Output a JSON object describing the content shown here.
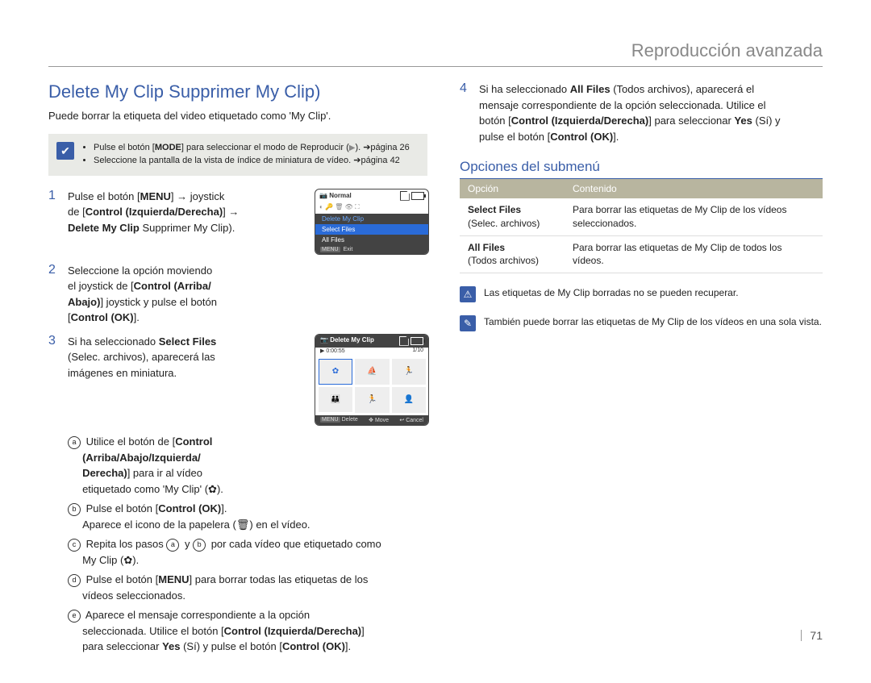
{
  "header": {
    "chapter": "Reproducción avanzada"
  },
  "title": "Delete My Clip Supprimer My Clip)",
  "intro": "Puede borrar la etiqueta del video etiquetado como 'My Clip'.",
  "note_box": {
    "b1a": "Pulse el botón [",
    "b1mode": "MODE",
    "b1b": "] para seleccionar el modo de Reproducir (",
    "b1c": "). ➔página 26",
    "b2": "Seleccione la pantalla de la vista de índice de miniatura de vídeo. ➔página 42"
  },
  "steps": {
    "s1": {
      "num": "1",
      "l1a": "Pulse el botón [",
      "l1b": "MENU",
      "l1c": "] → joystick",
      "l2a": "de [",
      "l2b": "Control (Izquierda/Derecha)",
      "l2c": "] →",
      "l3a": "Delete My Clip",
      "l3b": " Supprimer My Clip)."
    },
    "s2": {
      "num": "2",
      "l1": "Seleccione la opción moviendo",
      "l2a": "el joystick de [",
      "l2b": "Control (Arriba/",
      "l2c": "",
      "l3a": "Abajo)",
      "l3b": "] joystick y pulse el botón",
      "l4a": "[",
      "l4b": "Control (OK)",
      "l4c": "]."
    },
    "s3": {
      "num": "3",
      "l1a": "Si ha seleccionado ",
      "l1b": "Select Files",
      "l2": "(Selec. archivos), aparecerá las",
      "l3": "imágenes en miniatura.",
      "a": {
        "pre": "Utilice el botón de [",
        "bold1": "Control",
        "bold2": "(Arriba/Abajo/Izquierda/",
        "bold3": "Derecha)",
        "post": "] para ir al vídeo",
        "post2": "etiquetado como 'My Clip' (",
        "post3": ")."
      },
      "b": {
        "pre": "Pulse el botón [",
        "bold": "Control (OK)",
        "post": "].",
        "post2": "Aparece el icono de la papelera (",
        "post3": ") en el vídeo."
      },
      "c": {
        "pre": "Repita los pasos ",
        "mid1": " y ",
        "mid2": " por cada vídeo que etiquetado como",
        "post": "My Clip (",
        "post2": ")."
      },
      "d": {
        "pre": "Pulse el botón [",
        "bold": "MENU",
        "post": "] para borrar todas las etiquetas de los",
        "post2": "vídeos seleccionados."
      },
      "e": {
        "l1": "Aparece el mensaje correspondiente a la opción",
        "l2a": "seleccionada. Utilice el botón [",
        "l2b": "Control (Izquierda/Derecha)",
        "l2c": "]",
        "l3a": "para seleccionar ",
        "l3b": "Yes",
        "l3c": " (Sí) y pulse el botón [",
        "l3d": "Control (OK)",
        "l3e": "]."
      }
    },
    "s4": {
      "num": "4",
      "l1a": "Si ha seleccionado ",
      "l1b": "All Files",
      "l1c": " (Todos archivos), aparecerá el",
      "l2": "mensaje correspondiente de la opción seleccionada. Utilice el",
      "l3a": "botón [",
      "l3b": "Control (Izquierda/Derecha)",
      "l3c": "] para seleccionar ",
      "l3d": "Yes",
      "l3e": " (Sí) y",
      "l4a": "pulse el botón [",
      "l4b": "Control (OK)",
      "l4c": "]."
    }
  },
  "submenu": {
    "heading": "Opciones del submenú",
    "th1": "Opción",
    "th2": "Contenido",
    "r1": {
      "name": "Select Files",
      "sub": "(Selec. archivos)",
      "desc": "Para borrar las etiquetas de My Clip de los vídeos seleccionados."
    },
    "r2": {
      "name": "All Files",
      "sub": "(Todos archivos)",
      "desc": "Para borrar las etiquetas de My Clip de todos los vídeos."
    }
  },
  "callouts": {
    "warn": "Las etiquetas de My Clip borradas no se pueden recuperar.",
    "info": "También puede borrar las etiquetas de My Clip de los vídeos en una sola vista."
  },
  "lcd1": {
    "top_label": "Normal",
    "m1": "Delete My Clip",
    "m2": "Select Files",
    "m3": "All Files",
    "foot": "Exit",
    "foot_btn": "MENU"
  },
  "lcd2": {
    "title": "Delete My Clip",
    "time": "0:00:55",
    "count": "1/10",
    "f1_btn": "MENU",
    "f1": "Delete",
    "f2": "Move",
    "f3": "Cancel"
  },
  "page_number": "71"
}
